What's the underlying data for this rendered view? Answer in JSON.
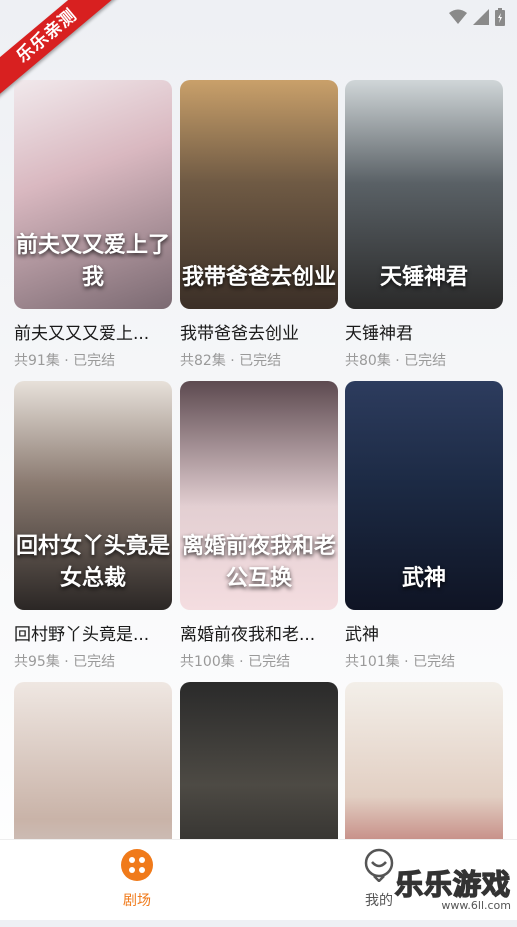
{
  "ribbon": "乐乐亲测",
  "items": [
    {
      "title": "前夫又又又爱上...",
      "meta": "共91集 · 已完结",
      "poster_text": "前夫又又爱上了我",
      "bg": "linear-gradient(160deg,#f1e9ec 0%,#d9b8c0 40%,#7b6a72 100%)"
    },
    {
      "title": "我带爸爸去创业",
      "meta": "共82集 · 已完结",
      "poster_text": "我带爸爸去创业",
      "bg": "linear-gradient(180deg,#c9a06a 0%,#6f5a44 45%,#3b2f27 100%)"
    },
    {
      "title": "天锤神君",
      "meta": "共80集 · 已完结",
      "poster_text": "天锤神君",
      "bg": "linear-gradient(180deg,#d0d6d8 0%,#5a6166 45%,#2a2a2a 100%)"
    },
    {
      "title": "回村野丫头竟是...",
      "meta": "共95集 · 已完结",
      "poster_text": "回村女丫头竟是女总裁",
      "bg": "linear-gradient(180deg,#e7e1da 0%,#8a7a70 45%,#2b2725 100%)"
    },
    {
      "title": "离婚前夜我和老...",
      "meta": "共100集 · 已完结",
      "poster_text": "离婚前夜我和老公互换",
      "bg": "linear-gradient(180deg,#5d4a50 0%,#e3cfd2 55%,#f4dde0 100%)"
    },
    {
      "title": "武神",
      "meta": "共101集 · 已完结",
      "poster_text": "武神",
      "bg": "linear-gradient(180deg,#2d3c5e 0%,#1c2a44 45%,#0f1424 100%)"
    },
    {
      "title": "",
      "meta": "",
      "poster_text": "",
      "bg": "linear-gradient(180deg,#efe7e2 0%,#c9b3a8 60%,#d6d8db 100%)"
    },
    {
      "title": "",
      "meta": "",
      "poster_text": "",
      "bg": "linear-gradient(180deg,#2a2a2a 0%,#4d4a44 45%,#1c1c1c 100%)"
    },
    {
      "title": "",
      "meta": "",
      "poster_text": "",
      "bg": "linear-gradient(180deg,#f3efe9 0%,#e2cfc3 50%,#9c2b2b 100%)"
    }
  ],
  "tabs": [
    {
      "label": "剧场",
      "color": "#f07a1a"
    },
    {
      "label": "我的",
      "color": "#555555"
    }
  ],
  "watermark": {
    "main": "乐乐游戏",
    "url": "www.6ll.com"
  },
  "colors": {
    "accent": "#f07a1a",
    "ribbon": "#d82020"
  }
}
